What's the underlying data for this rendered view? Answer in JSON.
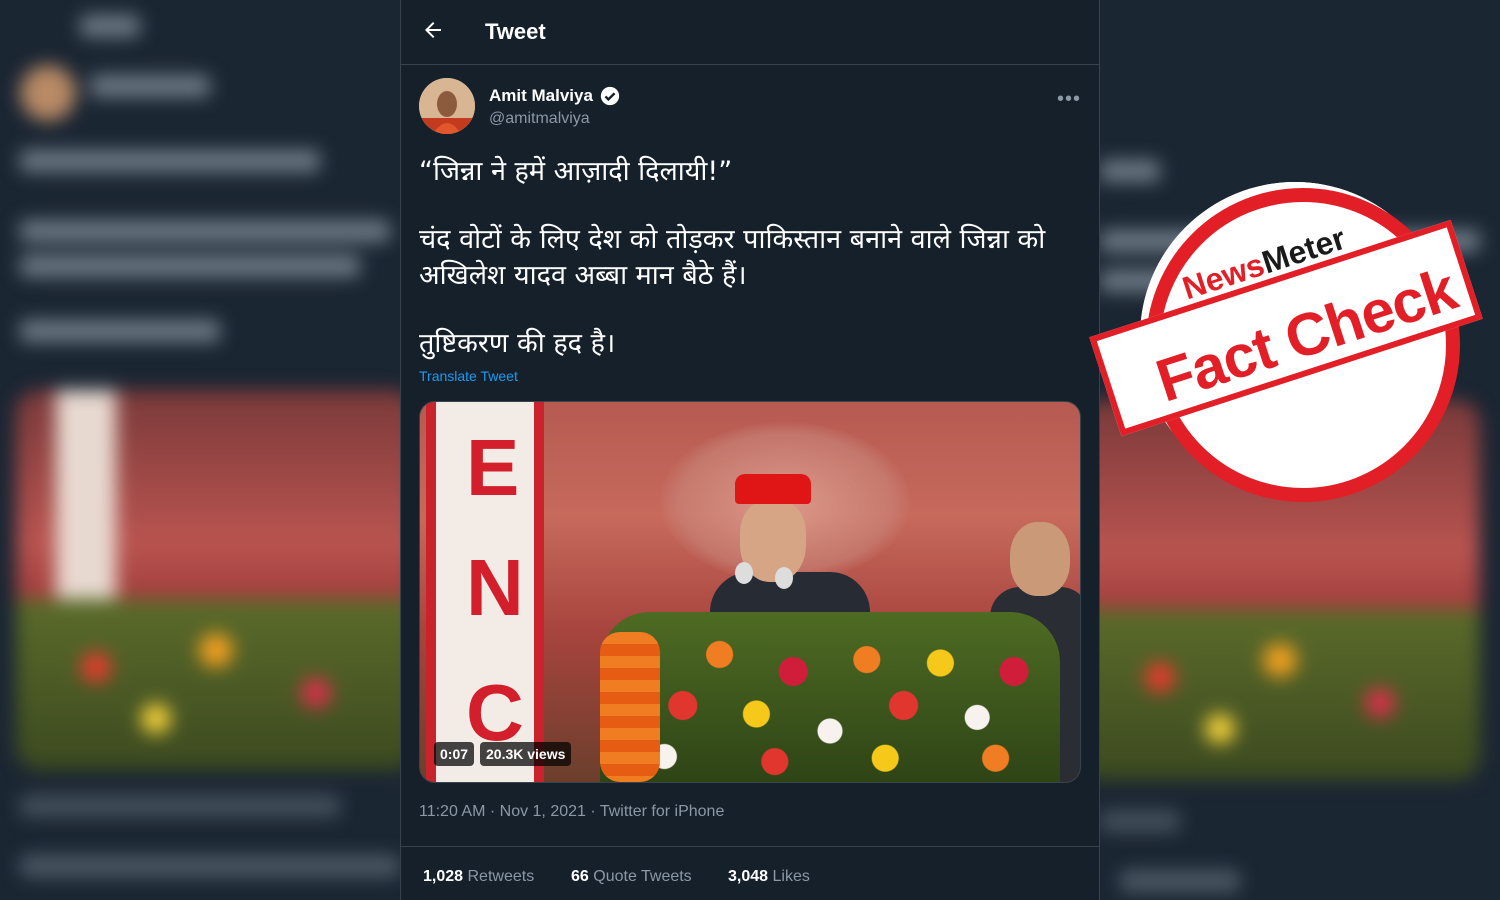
{
  "header": {
    "title": "Tweet"
  },
  "tweet": {
    "author_name": "Amit Malviya",
    "author_handle": "@amitmalviya",
    "text_lines": [
      "“जिन्ना ने हमें आज़ादी दिलायी!”",
      "चंद वोटों के लिए देश को तोड़कर पाकिस्तान बनाने वाले जिन्ना को अखिलेश यादव अब्बा मान बैठे हैं।",
      "तुष्टिकरण की हद है।"
    ],
    "translate_label": "Translate Tweet",
    "video": {
      "duration": "0:07",
      "views": "20.3K views"
    },
    "timestamp": "11:20 AM · Nov 1, 2021 · Twitter for iPhone",
    "stats": {
      "retweets_count": "1,028",
      "retweets_label": "Retweets",
      "quotes_count": "66",
      "quotes_label": "Quote Tweets",
      "likes_count": "3,048",
      "likes_label": "Likes"
    }
  },
  "stamp": {
    "brand_part1": "News",
    "brand_part2": "Meter",
    "label": "Fact Check"
  },
  "colors": {
    "background": "#15202b",
    "accent": "#1d9bf0",
    "stamp_red": "#e21f26"
  }
}
